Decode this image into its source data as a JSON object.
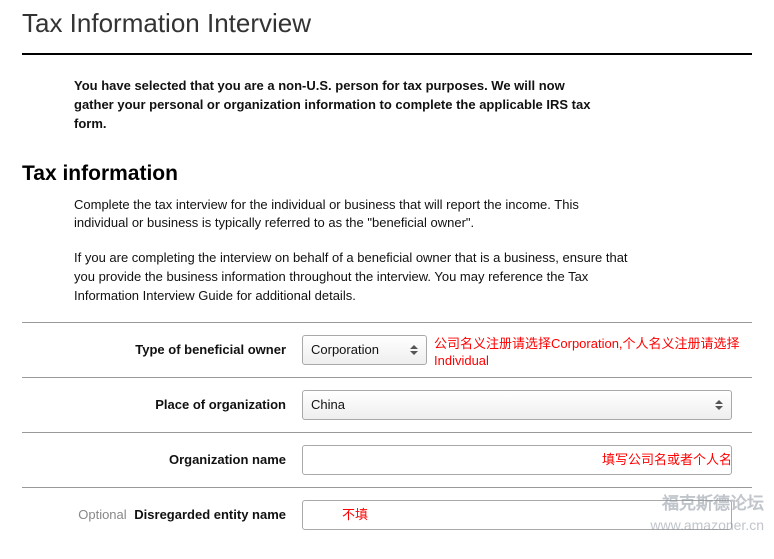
{
  "page": {
    "title": "Tax Information Interview",
    "intro": "You have selected that you are a non-U.S. person for tax purposes. We will now gather your personal or organization information to complete the applicable IRS tax form."
  },
  "section": {
    "heading": "Tax information",
    "p1": "Complete the tax interview for the individual or business that will report the income. This individual or business is typically referred to as the \"beneficial owner\".",
    "p2": "If you are completing the interview on behalf of a beneficial owner that is a business, ensure that you provide the business information throughout the interview. You may reference the Tax Information Interview Guide for additional details."
  },
  "form": {
    "type_label": "Type of beneficial owner",
    "type_value": "Corporation",
    "place_label": "Place of organization",
    "place_value": "China",
    "org_label": "Organization name",
    "org_value": "",
    "disregarded_optional": "Optional",
    "disregarded_label": "Disregarded entity name",
    "disregarded_value": ""
  },
  "annotations": {
    "type_note": "公司名义注册请选择Corporation,个人名义注册请选择Individual",
    "org_note": "填写公司名或者个人名",
    "disregarded_note": "不填"
  },
  "watermark": {
    "line1": "福克斯德论坛",
    "line2": "www.amazoner.cn"
  }
}
